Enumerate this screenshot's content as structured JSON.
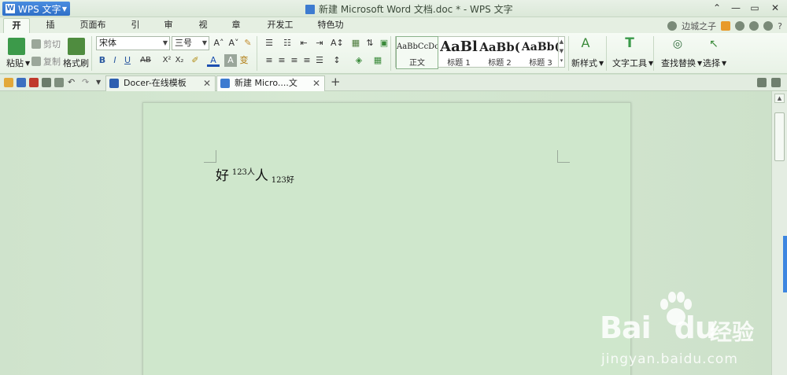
{
  "app": {
    "menu_label": "WPS 文字",
    "logo_text": "W",
    "window_title": "新建 Microsoft Word 文档.doc * - WPS 文字"
  },
  "tabs": [
    "开始",
    "插入",
    "页面布局",
    "引用",
    "审阅",
    "视图",
    "章节",
    "开发工具",
    "特色功能"
  ],
  "tabs_right": {
    "user": "边城之子"
  },
  "ribbon": {
    "paste": "粘贴",
    "cut": "剪切",
    "copy": "复制",
    "format_painter": "格式刷",
    "font_name": "宋体",
    "font_size": "三号",
    "bold": "B",
    "italic": "I",
    "underline": "U",
    "strike": "AB",
    "superscript": "X²",
    "subscript": "X₂",
    "font_color": "A",
    "char_shading": "A",
    "phonetic": "变",
    "styles": [
      {
        "preview": "AaBbCcDc",
        "name": "正文"
      },
      {
        "preview": "AaBl",
        "name": "标题 1"
      },
      {
        "preview": "AaBb(",
        "name": "标题 2"
      },
      {
        "preview": "AaBb(",
        "name": "标题 3"
      }
    ],
    "new_style": "新样式",
    "text_tools": "文字工具",
    "find_replace": "查找替换",
    "select": "选择"
  },
  "doc_tabs": [
    {
      "label": "Docer-在线模板"
    },
    {
      "label": "新建 Micro....文档.doc *"
    }
  ],
  "document": {
    "runs": [
      {
        "text": "好",
        "style": "big"
      },
      {
        "text": "123",
        "style": "sup"
      },
      {
        "text": "人",
        "style": "sup"
      },
      {
        "text": "人",
        "style": "big"
      },
      {
        "text": "123",
        "style": "sub"
      },
      {
        "text": "好",
        "style": "sub"
      }
    ]
  },
  "watermark": {
    "brand": "Bai",
    "brand2": "du",
    "cn": "经验",
    "url": "jingyan.baidu.com"
  },
  "colors": {
    "accent": "#2f6fc7",
    "page_bg": "#cfe7cc",
    "workspace_bg": "#d3e6d0"
  }
}
